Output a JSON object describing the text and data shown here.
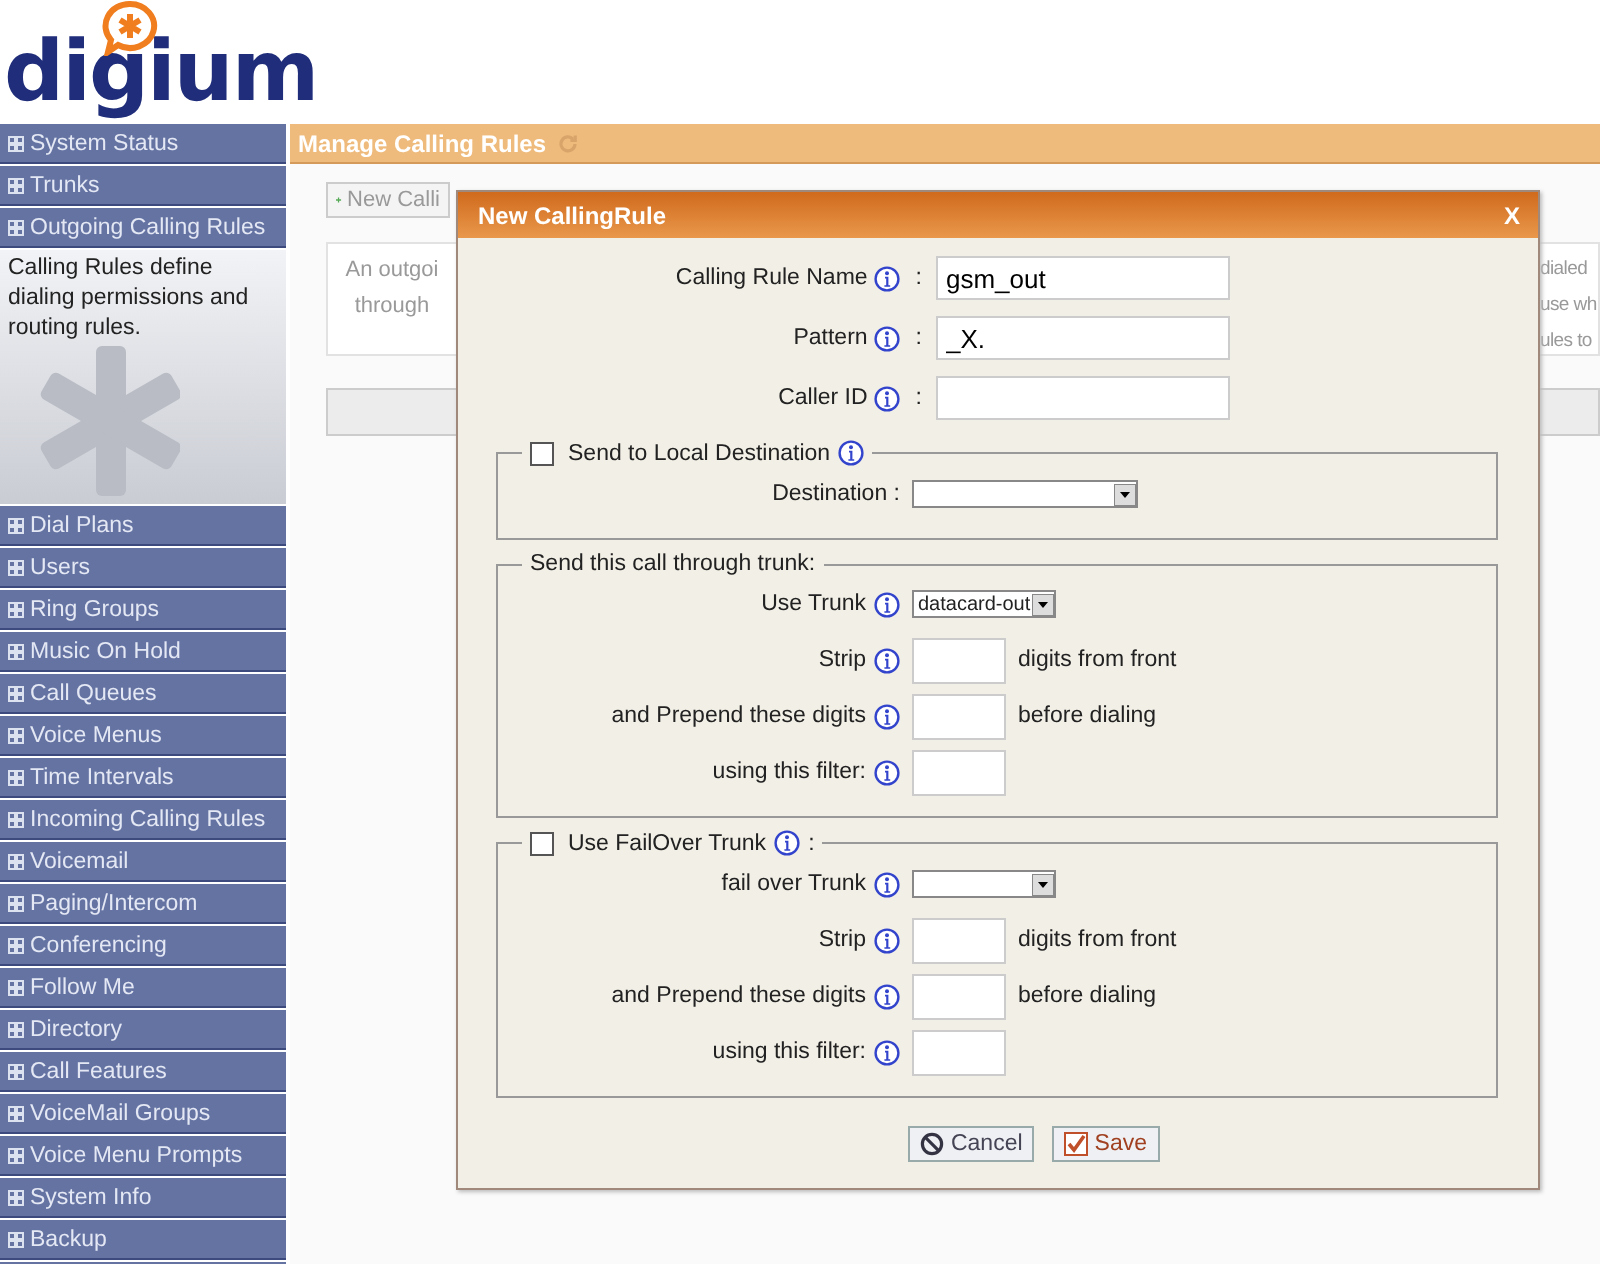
{
  "logo": {
    "text": "digium"
  },
  "sidebar": {
    "items": [
      {
        "label": "System Status"
      },
      {
        "label": "Trunks"
      },
      {
        "label": "Outgoing Calling Rules",
        "description": "Calling Rules define dialing permissions and routing rules."
      },
      {
        "label": "Dial Plans"
      },
      {
        "label": "Users"
      },
      {
        "label": "Ring Groups"
      },
      {
        "label": "Music On Hold"
      },
      {
        "label": "Call Queues"
      },
      {
        "label": "Voice Menus"
      },
      {
        "label": "Time Intervals"
      },
      {
        "label": "Incoming Calling Rules"
      },
      {
        "label": "Voicemail"
      },
      {
        "label": "Paging/Intercom"
      },
      {
        "label": "Conferencing"
      },
      {
        "label": "Follow Me"
      },
      {
        "label": "Directory"
      },
      {
        "label": "Call Features"
      },
      {
        "label": "VoiceMail Groups"
      },
      {
        "label": "Voice Menu Prompts"
      },
      {
        "label": "System Info"
      },
      {
        "label": "Backup"
      }
    ]
  },
  "main": {
    "title": "Manage Calling Rules",
    "new_button": "New Calli",
    "info_left": [
      "An outgoi",
      "through"
    ],
    "info_right": [
      "dialed",
      "use wh",
      "ules to"
    ]
  },
  "dialog": {
    "title": "New CallingRule",
    "close": "X",
    "fields": [
      {
        "label": "Calling Rule Name",
        "separator": ":",
        "value": "gsm_out"
      },
      {
        "label": "Pattern",
        "separator": ":",
        "value": "_X."
      },
      {
        "label": "Caller ID",
        "separator": ":"
      }
    ],
    "sections": [
      {
        "kind": "checkbox",
        "legend": "Send to Local Destination",
        "checked": false,
        "rows": [
          {
            "kind": "select",
            "label": "Destination :",
            "info": false
          }
        ]
      },
      {
        "kind": "plain",
        "legend": "Send this call through trunk:",
        "rows": [
          {
            "kind": "select",
            "label": "Use Trunk",
            "info": true,
            "value": "datacard-out"
          },
          {
            "kind": "text",
            "label": "Strip",
            "info": true,
            "suffix": "digits from front"
          },
          {
            "kind": "text",
            "label": "and Prepend these digits",
            "info": true,
            "suffix": "before dialing"
          },
          {
            "kind": "text",
            "label": "using this filter:",
            "info": true
          }
        ]
      },
      {
        "kind": "checkbox",
        "legend": "Use FailOver Trunk",
        "legend_suffix": ":",
        "checked": false,
        "rows": [
          {
            "kind": "select",
            "label": "fail over Trunk",
            "info": true
          },
          {
            "kind": "text",
            "label": "Strip",
            "info": true,
            "suffix": "digits from front"
          },
          {
            "kind": "text",
            "label": "and Prepend these digits",
            "info": true,
            "suffix": "before dialing"
          },
          {
            "kind": "text",
            "label": "using this filter:",
            "info": true
          }
        ]
      }
    ],
    "buttons": [
      {
        "kind": "cancel",
        "label": "Cancel"
      },
      {
        "kind": "save",
        "label": "Save"
      }
    ]
  }
}
